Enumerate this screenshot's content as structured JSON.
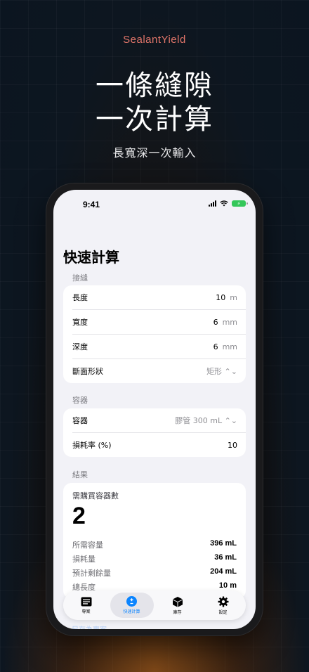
{
  "promo": {
    "brand": "SealantYield",
    "headline_line1": "一條縫隙",
    "headline_line2": "一次計算",
    "subhead": "長寬深一次輸入"
  },
  "status_bar": {
    "time": "9:41"
  },
  "screen": {
    "title": "快速計算",
    "joint": {
      "section": "接縫",
      "rows": [
        {
          "label": "長度",
          "value": "10",
          "unit": "m"
        },
        {
          "label": "寬度",
          "value": "6",
          "unit": "mm"
        },
        {
          "label": "深度",
          "value": "6",
          "unit": "mm"
        },
        {
          "label": "斷面形狀",
          "value": "矩形 ⌃⌄"
        }
      ]
    },
    "container": {
      "section": "容器",
      "rows": [
        {
          "label": "容器",
          "value": "膠管 300 mL ⌃⌄"
        },
        {
          "label": "損耗率 (%)",
          "value": "10"
        }
      ]
    },
    "results": {
      "section": "結果",
      "title": "需購買容器數",
      "count": "2",
      "rows": [
        {
          "label": "所需容量",
          "value": "396 mL"
        },
        {
          "label": "損耗量",
          "value": "36 mL"
        },
        {
          "label": "預計剩餘量",
          "value": "204 mL"
        },
        {
          "label": "總長度",
          "value": "10 m"
        }
      ]
    },
    "ghost_action": "另存為專案"
  },
  "tabbar": {
    "tabs": [
      {
        "label": "專案",
        "icon": "list-icon",
        "active": false
      },
      {
        "label": "快速計算",
        "icon": "plus-minus-icon",
        "active": true
      },
      {
        "label": "庫存",
        "icon": "box-icon",
        "active": false
      },
      {
        "label": "設定",
        "icon": "gear-icon",
        "active": false
      }
    ]
  },
  "colors": {
    "brand": "#e2766a",
    "accent": "#0a84ff",
    "battery": "#34c759"
  }
}
